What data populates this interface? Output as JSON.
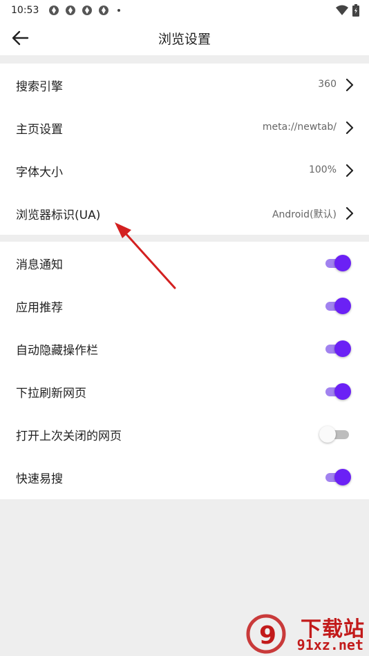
{
  "status_bar": {
    "time": "10:53",
    "app_icons": [
      "app-icon",
      "app-icon",
      "app-icon",
      "app-icon"
    ]
  },
  "header": {
    "title": "浏览设置",
    "back_icon": "arrow-left-icon"
  },
  "settings_nav": [
    {
      "label": "搜索引擎",
      "value": "360"
    },
    {
      "label": "主页设置",
      "value": "meta://newtab/"
    },
    {
      "label": "字体大小",
      "value": "100%"
    },
    {
      "label": "浏览器标识(UA)",
      "value": "Android(默认)"
    }
  ],
  "settings_toggles": [
    {
      "label": "消息通知",
      "enabled": true
    },
    {
      "label": "应用推荐",
      "enabled": true
    },
    {
      "label": "自动隐藏操作栏",
      "enabled": true
    },
    {
      "label": "下拉刷新网页",
      "enabled": true
    },
    {
      "label": "打开上次关闭的网页",
      "enabled": false
    },
    {
      "label": "快速易搜",
      "enabled": true
    }
  ],
  "colors": {
    "accent": "#6b21f5",
    "accent_track": "#a182ef",
    "annotation": "#d32020",
    "watermark": "#c21a1a"
  },
  "watermark": {
    "brand": "下载站",
    "domain": "91xz.net",
    "logo_text": "9"
  }
}
